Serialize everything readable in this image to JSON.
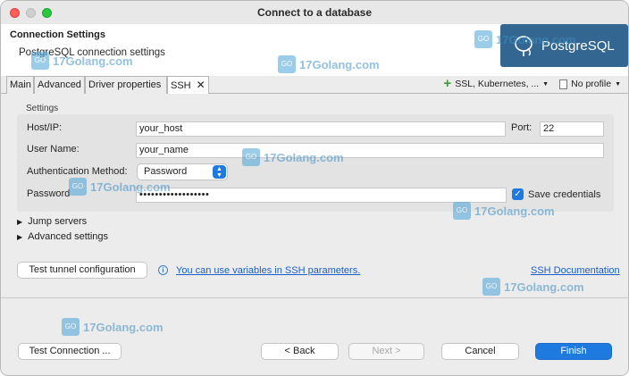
{
  "window": {
    "title": "Connect to a database"
  },
  "header": {
    "title": "Connection Settings",
    "subtitle": "PostgreSQL connection settings",
    "logo_text": "PostgreSQL"
  },
  "tabs": [
    {
      "label": "Main"
    },
    {
      "label": "Advanced"
    },
    {
      "label": "Driver properties"
    },
    {
      "label": "SSH",
      "close": "✕"
    }
  ],
  "tab_tools": {
    "add_label": "SSL, Kubernetes, ...",
    "profile_label": "No profile"
  },
  "settings": {
    "group_label": "Settings",
    "host_label": "Host/IP:",
    "host_value": "your_host",
    "port_label": "Port:",
    "port_value": "22",
    "user_label": "User Name:",
    "user_value": "your_name",
    "auth_label": "Authentication Method:",
    "auth_value": "Password",
    "password_label": "Password",
    "password_value": "••••••••••••••••••",
    "save_credentials_label": "Save credentials",
    "save_credentials_checked": true
  },
  "expanders": {
    "jump_servers": "Jump servers",
    "advanced_settings": "Advanced settings"
  },
  "tunnel": {
    "test_button": "Test tunnel configuration",
    "info_link": "You can use variables in SSH parameters.",
    "docs_link": "SSH Documentation"
  },
  "footer": {
    "test_connection": "Test Connection ...",
    "back": "< Back",
    "next": "Next >",
    "cancel": "Cancel",
    "finish": "Finish"
  },
  "watermark": {
    "text": "17Golang.com",
    "logo": "GO"
  },
  "colors": {
    "accent": "#1f7ae0",
    "postgres_brand": "#336791",
    "link": "#1a5fc9"
  }
}
